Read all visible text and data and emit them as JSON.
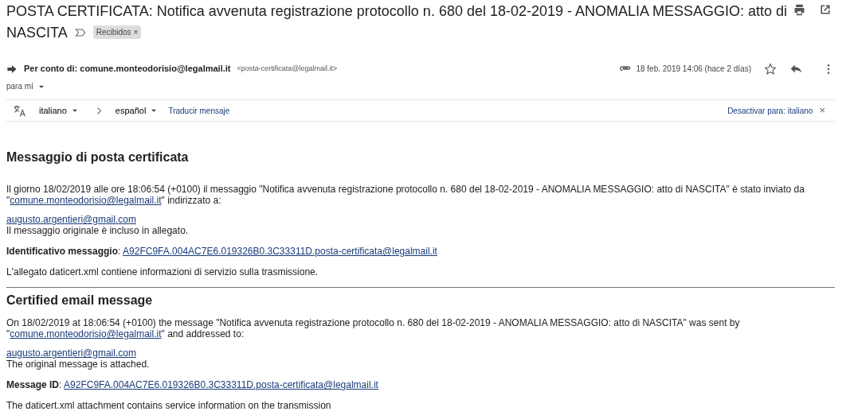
{
  "subject_lines": [
    "POSTA CERTIFICATA: Notifica avvenuta registrazione protocollo n. 680 del 18-02-2019 - ANOMALIA MESSAGGIO: atto di",
    "NASCITA"
  ],
  "label_chip": {
    "text": "Recibidos",
    "close": "×"
  },
  "sender": {
    "name": "Per conto di: comune.monteodorisio@legalmail.it",
    "address": "<posta-certificata@legalmail.it>",
    "to": "para mí",
    "date": "18 feb. 2019 14:06 (hace 2 días)",
    "starred": false
  },
  "translate_bar": {
    "from": "italiano",
    "to": "español",
    "action": "Traducir mensaje",
    "disable": "Desactivar para: italiano",
    "close": "×"
  },
  "sections": [
    {
      "heading": "Messaggio di posta certificata",
      "intro_before": "Il giorno 18/02/2019 alle ore 18:06:54 (+0100) il messaggio \"Notifica avvenuta registrazione protocollo n. 680 del 18-02-2019 - ANOMALIA MESSAGGIO: atto di NASCITA\" è stato inviato da \"",
      "sender_link": "comune.monteodorisio@legalmail.it",
      "intro_after": "\" indirizzato a:",
      "recipient": "augusto.argentieri@gmail.com",
      "attached_note": "Il messaggio originale è incluso in allegato.",
      "id_label": "**Identificativo messaggio**:",
      "id_value": "A92FC9FA.004AC7E6.019326B0.3C33311D.posta-certificata@legalmail.it",
      "footer_note": "L'allegato daticert.xml contiene informazioni di servizio sulla trasmissione."
    },
    {
      "heading": "Certified email message",
      "intro_before": "On 18/02/2019 at 18:06:54 (+0100) the message \"Notifica avvenuta registrazione protocollo n. 680 del 18-02-2019 - ANOMALIA MESSAGGIO: atto di NASCITA\" was sent by \"",
      "sender_link": "comune.monteodorisio@legalmail.it",
      "intro_after": "\" and addressed to:",
      "recipient": "augusto.argentieri@gmail.com",
      "attached_note": "The original message is attached.",
      "id_label": "**Message ID**:",
      "id_value": "A92FC9FA.004AC7E6.019326B0.3C33311D.posta-certificata@legalmail.it",
      "footer_note": "The daticert.xml attachment contains service information on the transmission"
    }
  ]
}
